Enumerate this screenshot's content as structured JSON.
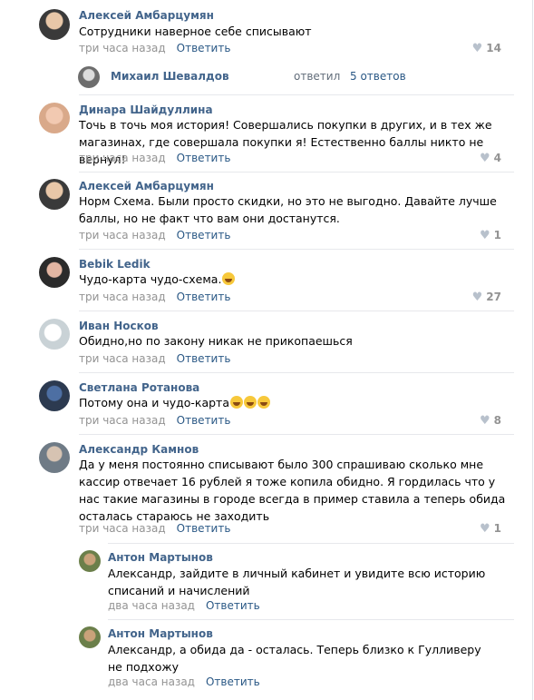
{
  "comments": [
    {
      "name": "Алексей Амбарцумян",
      "text": "Сотрудники наверное себе списывают",
      "time": "три часа назад",
      "reply": "Ответить",
      "likes": "14"
    },
    {
      "name": "Динара Шайдуллина",
      "text": "Точь в точь моя история! Совершались покупки в других, и в тех же магазинах, где совершала покупки я! Естественно баллы никто не вернул!",
      "time": "три часа назад",
      "reply": "Ответить",
      "likes": "4"
    },
    {
      "name": "Алексей Амбарцумян",
      "text": "Норм Схема. Были просто скидки, но это не выгодно. Давайте лучше баллы, но не факт что вам они достанутся.",
      "time": "три часа назад",
      "reply": "Ответить",
      "likes": "1"
    },
    {
      "name": "Bebik Ledik",
      "text": "Чудо-карта чудо-схема.",
      "time": "три часа назад",
      "reply": "Ответить",
      "likes": "27"
    },
    {
      "name": "Иван Носков",
      "text": "Обидно,но по закону никак не прикопаешься",
      "time": "три часа назад",
      "reply": "Ответить",
      "likes": ""
    },
    {
      "name": "Светлана Ротанова",
      "text": "Потому она и чудо-карта",
      "time": "три часа назад",
      "reply": "Ответить",
      "likes": "8"
    },
    {
      "name": "Александр Камнов",
      "text": "Да у меня постоянно списывают было 300 спрашиваю сколько мне кассир отвечает 16 рублей я тоже копила обидно. Я гордилась что у нас такие магазины в городе всегда в пример ставила а теперь обида осталась стараюсь не заходить",
      "time": "три часа назад",
      "reply": "Ответить",
      "likes": "1"
    }
  ],
  "thread": {
    "name": "Михаил Шевалдов",
    "replied": "ответил",
    "count": "5 ответов"
  },
  "replies": [
    {
      "name": "Антон Мартынов",
      "text": "Александр, зайдите в личный кабинет и увидите всю историю списаний и начислений",
      "time": "два часа назад",
      "reply": "Ответить"
    },
    {
      "name": "Антон Мартынов",
      "text": "Александр, а обида да - осталась. Теперь близко к Гулливеру не подхожу",
      "time": "два часа назад",
      "reply": "Ответить"
    }
  ],
  "colors": {
    "link": "#42648b",
    "reply": "#2a5885",
    "meta": "#939393"
  }
}
